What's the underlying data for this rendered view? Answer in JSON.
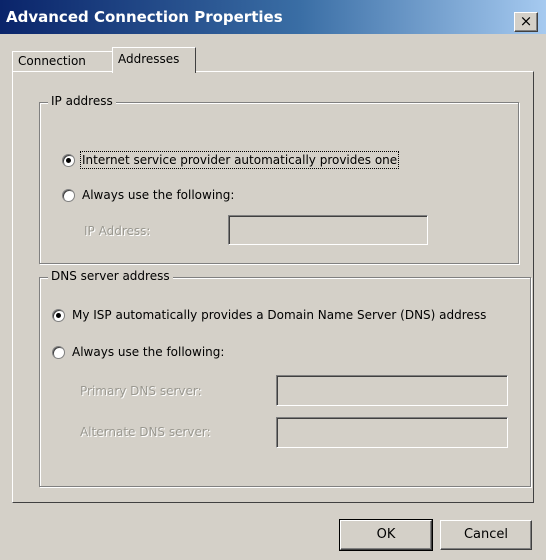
{
  "window": {
    "title": "Advanced Connection Properties",
    "close_glyph": "×"
  },
  "tabs": [
    {
      "label": "Connection",
      "active": false
    },
    {
      "label": "Addresses",
      "active": true
    }
  ],
  "ip_group": {
    "legend": "IP address",
    "option_auto": "Internet service provider automatically provides one",
    "option_manual": "Always use the following:",
    "ip_label": "IP Address:",
    "ip_value": ""
  },
  "dns_group": {
    "legend": "DNS server address",
    "option_auto": "My ISP automatically provides a Domain Name Server (DNS) address",
    "option_manual": "Always use the following:",
    "primary_label": "Primary DNS server:",
    "primary_value": "",
    "alternate_label": "Alternate DNS server:",
    "alternate_value": ""
  },
  "buttons": {
    "ok": "OK",
    "cancel": "Cancel"
  }
}
